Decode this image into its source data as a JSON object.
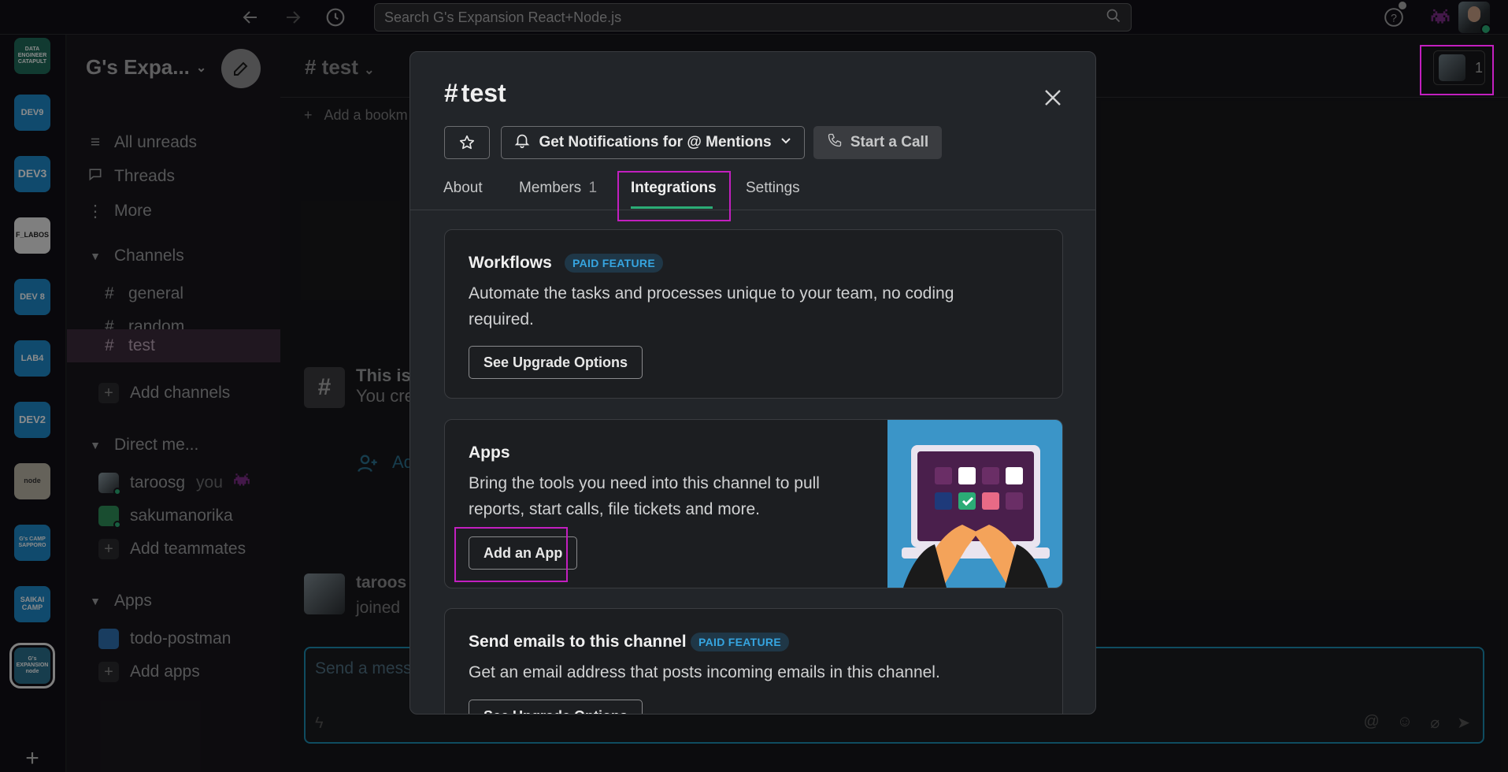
{
  "topbar": {
    "search_placeholder": "Search G's Expansion React+Node.js"
  },
  "workspaces": [
    {
      "label": "DATA ENGINEER CATAPULT",
      "color": "#1f6b5a"
    },
    {
      "label": "DEV9",
      "color": "#1e88c7"
    },
    {
      "label": "DEV3",
      "color": "#1e88c7"
    },
    {
      "label": "F_LABOS",
      "color": "#e8e8e8"
    },
    {
      "label": "DEV 8",
      "color": "#1e88c7"
    },
    {
      "label": "LAB4",
      "color": "#1e88c7"
    },
    {
      "label": "DEV2",
      "color": "#1e88c7"
    },
    {
      "label": "node",
      "color": "#b9b3a5"
    },
    {
      "label": "G's CAMP SAPPORO",
      "color": "#1e88c7"
    },
    {
      "label": "SAIKAI CAMP",
      "color": "#1e88c7"
    },
    {
      "label": "G's EXPANSION node",
      "color": "#2b6f8c"
    }
  ],
  "sidebar": {
    "workspace_name": "G's Expa...",
    "nav": [
      {
        "icon": "list-icon",
        "label": "All unreads"
      },
      {
        "icon": "threads-icon",
        "label": "Threads"
      },
      {
        "icon": "more-icon",
        "label": "More"
      }
    ],
    "channels_header": "Channels",
    "channels": [
      "general",
      "random",
      "test"
    ],
    "active_channel": "test",
    "add_channels": "Add channels",
    "dm_header": "Direct me...",
    "dms": [
      {
        "name": "taroosg",
        "suffix": "you"
      },
      {
        "name": "sakumanorika",
        "suffix": ""
      }
    ],
    "add_teammates": "Add teammates",
    "apps_header": "Apps",
    "apps": [
      "todo-postman"
    ],
    "add_apps": "Add apps"
  },
  "channel": {
    "title": "# test",
    "bookmark": "Add a bookm",
    "member_count": "1",
    "intro_title": "This is",
    "intro_text": "You cre",
    "add_people": "Ad",
    "join_name": "taroos",
    "join_text": "joined",
    "composer_placeholder": "Send a mess"
  },
  "modal": {
    "hash": "#",
    "title": "test",
    "notifications_label": "Get Notifications for @ Mentions",
    "call_label": "Start a Call",
    "tabs": [
      {
        "label": "About"
      },
      {
        "label": "Members",
        "count": "1"
      },
      {
        "label": "Integrations"
      },
      {
        "label": "Settings"
      }
    ],
    "active_tab": "Integrations",
    "cards": {
      "workflows": {
        "title": "Workflows",
        "badge": "PAID FEATURE",
        "desc1": "Automate the tasks and processes unique to your team, no coding",
        "desc2": "required.",
        "button": "See Upgrade Options"
      },
      "apps": {
        "title": "Apps",
        "desc1": "Bring the tools you need into this channel to pull",
        "desc2": "reports, start calls, file tickets and more.",
        "button": "Add an App"
      },
      "emails": {
        "title": "Send emails to this channel",
        "badge": "PAID FEATURE",
        "desc1": "Get an email address that posts incoming emails in this channel.",
        "button": "See Upgrade Options"
      }
    }
  },
  "colors": {
    "accent_green": "#2bac76",
    "highlight": "#c21fbf",
    "badge_blue": "#36a5e0"
  }
}
